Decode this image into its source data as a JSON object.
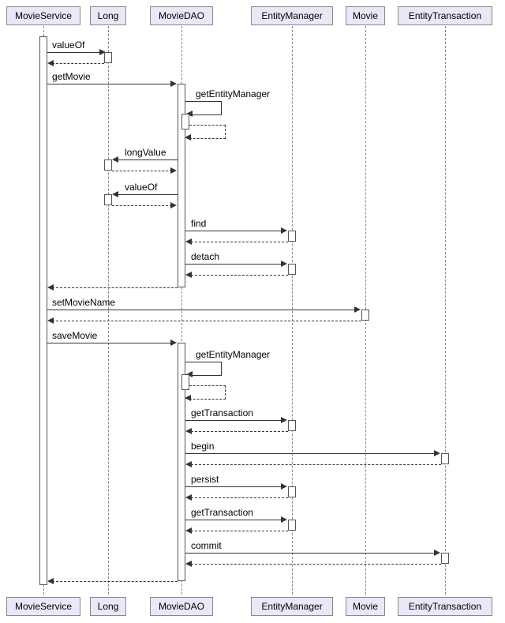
{
  "participants": {
    "movieService": "MovieService",
    "long": "Long",
    "movieDAO": "MovieDAO",
    "entityManager": "EntityManager",
    "movie": "Movie",
    "entityTransaction": "EntityTransaction"
  },
  "messages": {
    "valueOf1": "valueOf",
    "getMovie": "getMovie",
    "getEntityManager1": "getEntityManager",
    "longValue": "longValue",
    "valueOf2": "valueOf",
    "find": "find",
    "detach": "detach",
    "setMovieName": "setMovieName",
    "saveMovie": "saveMovie",
    "getEntityManager2": "getEntityManager",
    "getTransaction1": "getTransaction",
    "begin": "begin",
    "persist": "persist",
    "getTransaction2": "getTransaction",
    "commit": "commit"
  },
  "chart_data": {
    "type": "sequence-diagram",
    "participants": [
      "MovieService",
      "Long",
      "MovieDAO",
      "EntityManager",
      "Movie",
      "EntityTransaction"
    ],
    "interactions": [
      {
        "from": "MovieService",
        "to": "Long",
        "message": "valueOf",
        "return": true
      },
      {
        "from": "MovieService",
        "to": "MovieDAO",
        "message": "getMovie"
      },
      {
        "from": "MovieDAO",
        "to": "MovieDAO",
        "message": "getEntityManager",
        "self": true,
        "return": true
      },
      {
        "from": "MovieDAO",
        "to": "Long",
        "message": "longValue",
        "return": true
      },
      {
        "from": "MovieDAO",
        "to": "Long",
        "message": "valueOf",
        "return": true
      },
      {
        "from": "MovieDAO",
        "to": "EntityManager",
        "message": "find",
        "return": true
      },
      {
        "from": "MovieDAO",
        "to": "EntityManager",
        "message": "detach",
        "return": true
      },
      {
        "from": "MovieDAO",
        "to": "MovieService",
        "return_only": true
      },
      {
        "from": "MovieService",
        "to": "Movie",
        "message": "setMovieName",
        "return": true
      },
      {
        "from": "MovieService",
        "to": "MovieDAO",
        "message": "saveMovie"
      },
      {
        "from": "MovieDAO",
        "to": "MovieDAO",
        "message": "getEntityManager",
        "self": true,
        "return": true
      },
      {
        "from": "MovieDAO",
        "to": "EntityManager",
        "message": "getTransaction",
        "return": true
      },
      {
        "from": "MovieDAO",
        "to": "EntityTransaction",
        "message": "begin",
        "return": true
      },
      {
        "from": "MovieDAO",
        "to": "EntityManager",
        "message": "persist",
        "return": true
      },
      {
        "from": "MovieDAO",
        "to": "EntityManager",
        "message": "getTransaction",
        "return": true
      },
      {
        "from": "MovieDAO",
        "to": "EntityTransaction",
        "message": "commit",
        "return": true
      },
      {
        "from": "MovieDAO",
        "to": "MovieService",
        "return_only": true
      }
    ]
  }
}
